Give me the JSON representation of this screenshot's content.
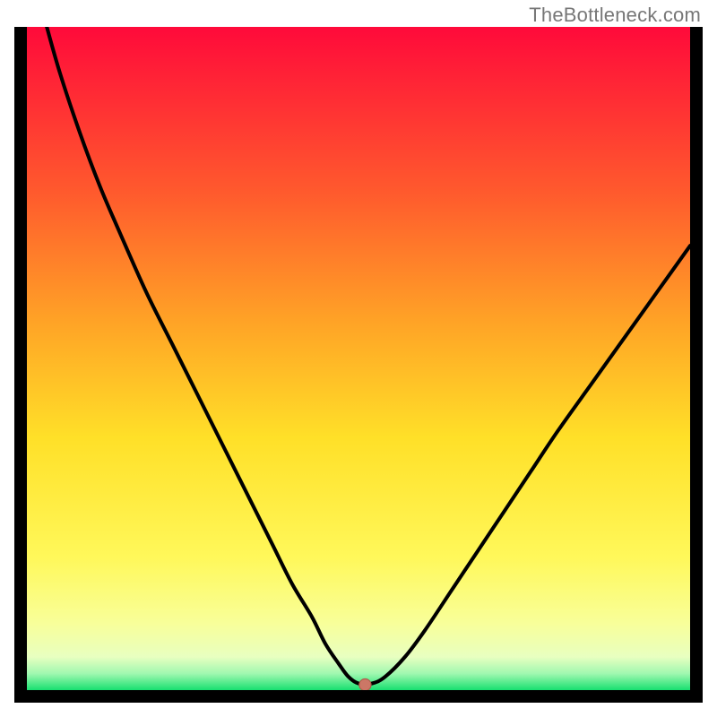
{
  "watermark": "TheBottleneck.com",
  "chart_data": {
    "type": "line",
    "title": "",
    "xlabel": "",
    "ylabel": "",
    "xlim": [
      0,
      100
    ],
    "ylim": [
      0,
      100
    ],
    "x": [
      3,
      5,
      8,
      11,
      14,
      18,
      22,
      26,
      30,
      34,
      37,
      40,
      43,
      45,
      47,
      48.5,
      50,
      52,
      54,
      57,
      60,
      64,
      68,
      72,
      76,
      80,
      85,
      90,
      95,
      100
    ],
    "y": [
      100,
      93,
      84,
      76,
      69,
      60,
      52,
      44,
      36,
      28,
      22,
      16,
      11,
      7,
      4,
      2,
      1,
      1,
      2,
      5,
      9,
      15,
      21,
      27,
      33,
      39,
      46,
      53,
      60,
      67
    ],
    "minimum_marker": {
      "x": 51,
      "y": 0.8
    },
    "gradient_stops": [
      {
        "pos": 0.0,
        "color": "#ff0a3a"
      },
      {
        "pos": 0.25,
        "color": "#ff5a2d"
      },
      {
        "pos": 0.45,
        "color": "#ffa526"
      },
      {
        "pos": 0.62,
        "color": "#ffe028"
      },
      {
        "pos": 0.8,
        "color": "#fff85a"
      },
      {
        "pos": 0.9,
        "color": "#f8ff9a"
      },
      {
        "pos": 0.95,
        "color": "#e8ffc0"
      },
      {
        "pos": 0.975,
        "color": "#a0f8b0"
      },
      {
        "pos": 1.0,
        "color": "#18e070"
      }
    ]
  }
}
